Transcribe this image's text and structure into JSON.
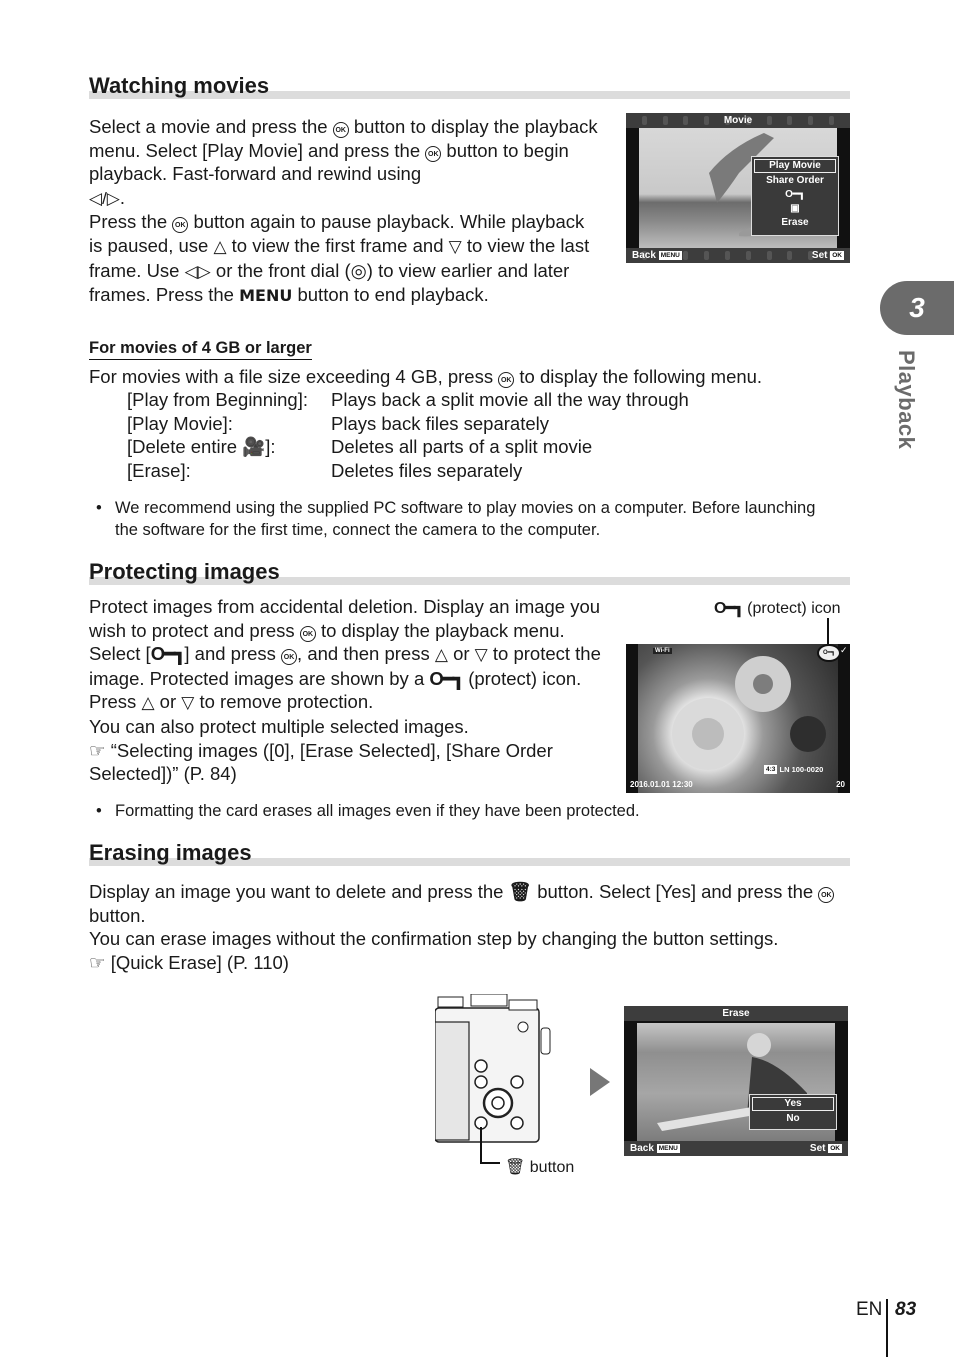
{
  "side_tab": {
    "chapter_number": "3",
    "chapter_label": "Playback",
    "color": "#6b6b6b"
  },
  "footer": {
    "lang": "EN",
    "page": "83"
  },
  "watching": {
    "title": "Watching movies",
    "p1_a": "Select a movie and press the",
    "p1_b": "button to display the playback menu. Select [Play Movie] and press the",
    "p1_c": "button to begin playback. Fast-forward and rewind using",
    "p1_d": ".",
    "p2_a": "Press the",
    "p2_b": "button again to pause playback. While playback is paused, use",
    "p2_c": "to view the first frame and",
    "p2_d": "to view the last frame. Use",
    "p2_e": "or the front dial (",
    "p2_f": ") to view earlier and later frames. Press the",
    "p2_menu": "MENU",
    "p2_g": "button to end playback.",
    "subhead": "For movies of 4 GB or larger",
    "sub_intro_a": "For movies with a file size exceeding 4 GB, press",
    "sub_intro_b": "to display the following menu.",
    "menu_rows": [
      {
        "item": "[Play from Beginning]:",
        "desc": "Plays back a split movie all the way through"
      },
      {
        "item": "[Play Movie]:",
        "desc": "Plays back files separately"
      },
      {
        "item_a": "[Delete entire ",
        "item_b": "]:",
        "desc": "Deletes all parts of a split movie"
      },
      {
        "item": "[Erase]:",
        "desc": "Deletes files separately"
      }
    ],
    "note": "We recommend using the supplied PC software to play movies on a computer. Before launching the software for the first time, connect the camera to the computer.",
    "screen": {
      "title": "Movie",
      "menu_items": [
        "Play Movie",
        "Share Order",
        "protect-icon",
        "share-icon",
        "Erase"
      ],
      "selected": "Play Movie",
      "back_label": "Back",
      "back_tag": "MENU",
      "set_label": "Set",
      "set_tag": "OK"
    }
  },
  "protecting": {
    "title": "Protecting images",
    "p_a": "Protect images from accidental deletion. Display an image you wish to protect and press",
    "p_b": "to display the playback menu. Select [",
    "p_c": "] and press",
    "p_d": ", and then press",
    "p_e": "or",
    "p_f": "to protect the image. Protected images are shown by a",
    "p_g": "(protect) icon. Press",
    "p_h": "or",
    "p_i": "to remove protection.",
    "p2": "You can also protect multiple selected images.",
    "ref": "“Selecting images ([0], [Erase Selected], [Share Order Selected])” (P. 84)",
    "callout": "(protect) icon",
    "note": "Formatting the card erases all images even if they have been protected.",
    "screen": {
      "wifi": "Wi-Fi",
      "aspect": "4:3",
      "quality": "LN",
      "file_no": "100-0020",
      "datetime": "2016.01.01 12:30",
      "count": "20"
    }
  },
  "erasing": {
    "title": "Erasing images",
    "p_a": "Display an image you want to delete and press the",
    "p_b": "button. Select [Yes] and press the",
    "p_c": "button.",
    "p2": "You can erase images without the confirmation step by changing the button settings.",
    "ref": "[Quick Erase] (P. 110)",
    "callout": "button",
    "screen": {
      "title": "Erase",
      "options": [
        "Yes",
        "No"
      ],
      "selected": "Yes",
      "back_label": "Back",
      "back_tag": "MENU",
      "set_label": "Set",
      "set_tag": "OK"
    }
  }
}
